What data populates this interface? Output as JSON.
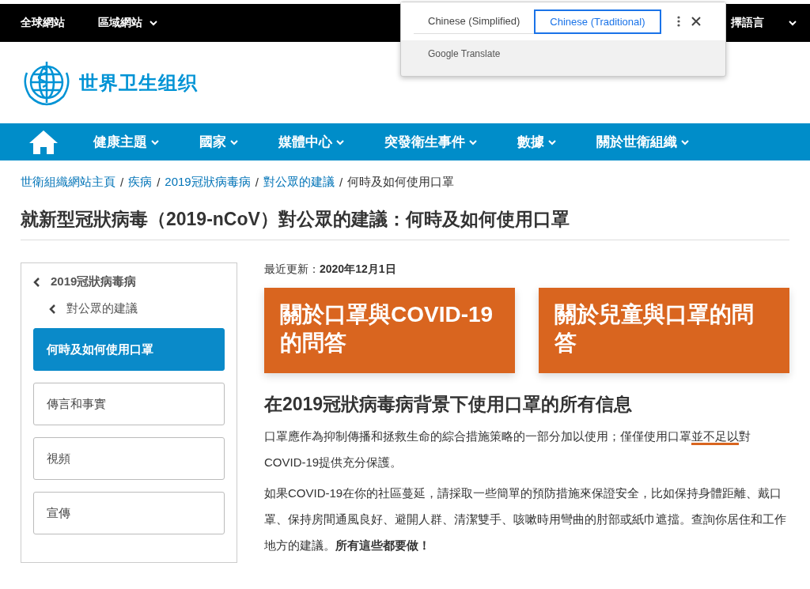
{
  "top_bar": {
    "links": [
      {
        "label": "全球網站",
        "has_caret": false
      },
      {
        "label": "區域網站",
        "has_caret": true
      }
    ],
    "language_label": "擇語言"
  },
  "translate_popup": {
    "tabs": [
      {
        "label": "Chinese (Simplified)",
        "selected": false
      },
      {
        "label": "Chinese (Traditional)",
        "selected": true
      }
    ],
    "footer": "Google Translate"
  },
  "logo": {
    "text": "世界卫生组织"
  },
  "nav": {
    "items": [
      "健康主題",
      "國家",
      "媒體中心",
      "突發衛生事件",
      "數據",
      "關於世衛組織"
    ]
  },
  "breadcrumb": {
    "links": [
      {
        "label": "世衛組織網站主頁",
        "separator": "/"
      },
      {
        "label": "疾病",
        "separator": "/"
      },
      {
        "label": "2019冠狀病毒病",
        "separator": "/"
      },
      {
        "label": "對公眾的建議",
        "separator": "/"
      }
    ],
    "current": "何時及如何使用口罩"
  },
  "page_title": "就新型冠狀病毒（2019-nCoV）對公眾的建議：何時及如何使用口罩",
  "sidebar": {
    "back_links": [
      "2019冠狀病毒病",
      "對公眾的建議"
    ],
    "items": [
      {
        "label": "何時及如何使用口罩",
        "selected": true
      },
      {
        "label": "傳言和事實",
        "selected": false
      },
      {
        "label": "視頻",
        "selected": false
      },
      {
        "label": "宣傳",
        "selected": false
      }
    ]
  },
  "updated": "最近更新：**2020年12月1日**",
  "cards": [
    "關於口罩與COVID-19的問答",
    "關於兒童與口罩的問答"
  ],
  "section_heading": "在2019冠狀病毒病背景下使用口罩的所有信息",
  "paragraphs": [
    {
      "before": "口罩應作為抑制傳播和拯救生命的綜合措施策略的一部分加以使用；僅僅使用口罩",
      "underlined": "並不足以",
      "after": "對COVID-19提供充分保護。"
    },
    {
      "before": "如果COVID-19在你的社區蔓延，請採取一些簡單的預防措施來保證安全，比如保持身體距離、戴口罩、保持房間通風良好、避開人群、清潔雙手、咳嗽時用彎曲的肘部或紙巾遮擋。查詢你居住和工作地方的建議。**所有這些都要做！**"
    }
  ]
}
